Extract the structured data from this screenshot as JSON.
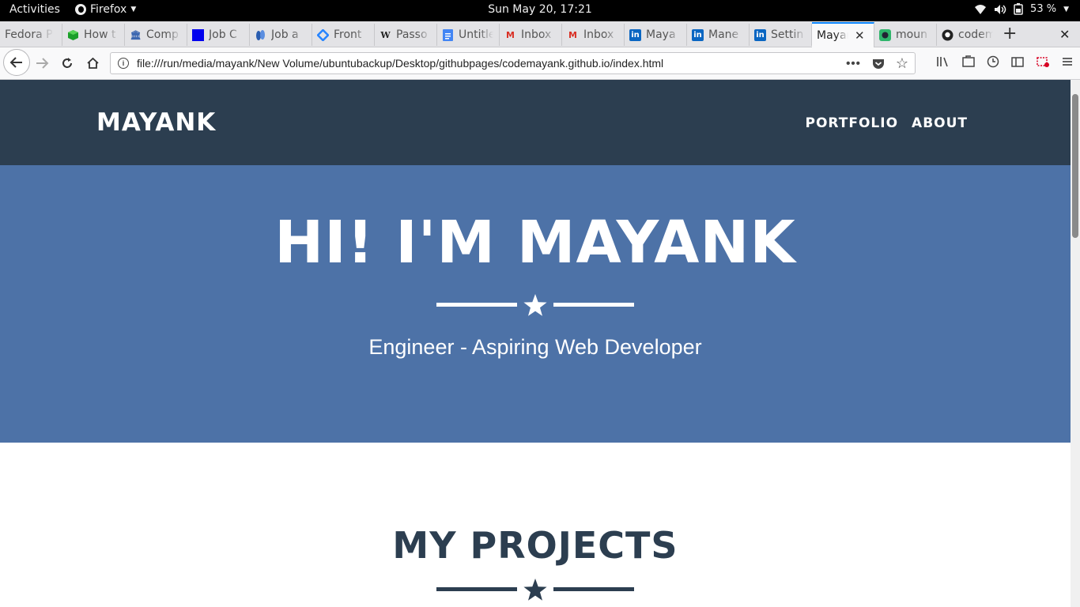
{
  "system": {
    "activities": "Activities",
    "app_name": "Firefox",
    "clock": "Sun May 20, 17:21",
    "battery": "53 %"
  },
  "browser": {
    "tabs": [
      {
        "label": "Fedora P",
        "icon": "fedora-icon"
      },
      {
        "label": "How t",
        "icon": "cube-icon"
      },
      {
        "label": "Comp",
        "icon": "bank-icon"
      },
      {
        "label": "Job C",
        "icon": "square-icon"
      },
      {
        "label": "Job a",
        "icon": "feet-icon"
      },
      {
        "label": "Front",
        "icon": "diamond-icon"
      },
      {
        "label": "Passo",
        "icon": "wikipedia-icon"
      },
      {
        "label": "Untitle",
        "icon": "docs-icon"
      },
      {
        "label": "Inbox",
        "icon": "gmail-icon"
      },
      {
        "label": "Inbox",
        "icon": "gmail-icon"
      },
      {
        "label": "Maya",
        "icon": "linkedin-icon"
      },
      {
        "label": "Mane",
        "icon": "linkedin-icon"
      },
      {
        "label": "Settin",
        "icon": "linkedin-icon"
      },
      {
        "label": "Mayan",
        "icon": "none",
        "active": true
      },
      {
        "label": "moun",
        "icon": "image-icon"
      },
      {
        "label": "codem",
        "icon": "github-icon"
      }
    ],
    "url": "file:///run/media/mayank/New Volume/ubuntubackup/Desktop/githubpages/codemayank.github.io/index.html"
  },
  "site": {
    "brand": "MAYANK",
    "menu": [
      "PORTFOLIO",
      "ABOUT"
    ],
    "hero_title": "HI! I'M MAYANK",
    "hero_subtitle": "Engineer - Aspiring Web Developer",
    "section_title": "MY PROJECTS"
  },
  "colors": {
    "nav_bg": "#2c3e50",
    "hero_bg": "#4d72a7",
    "accent": "#ffffff"
  }
}
